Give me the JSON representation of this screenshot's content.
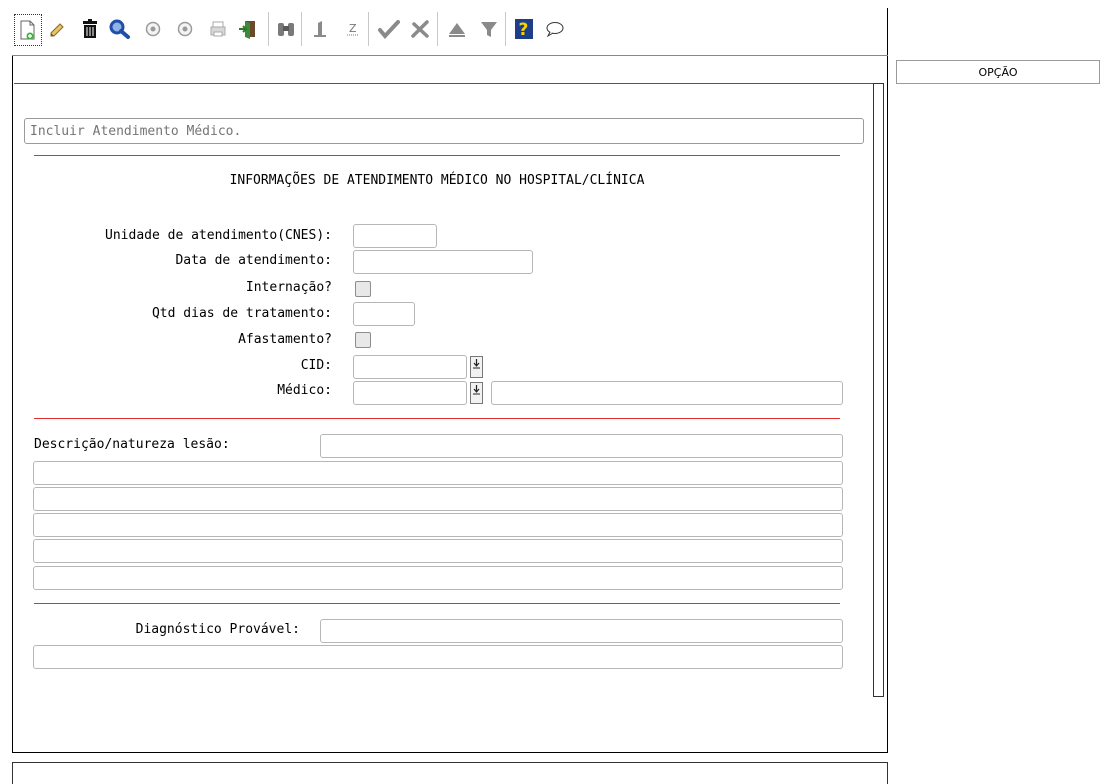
{
  "toolbar": {
    "icons": [
      "new-document-icon",
      "edit-pencil-icon",
      "trash-icon",
      "search-magnifier-icon",
      "previous-circle-icon",
      "next-circle-icon",
      "print-icon",
      "exit-door-icon",
      "binoculars-icon",
      "first-record-icon",
      "last-record-icon",
      "confirm-check-icon",
      "cancel-x-icon",
      "up-arrow-icon",
      "filter-icon",
      "help-question-icon",
      "comment-balloon-icon"
    ]
  },
  "side": {
    "option_label": "OPÇÃO"
  },
  "form": {
    "status_placeholder": "Incluir Atendimento Médico.",
    "section_title": "INFORMAÇÕES DE ATENDIMENTO MÉDICO NO HOSPITAL/CLÍNICA",
    "fields": {
      "cnes_label": "Unidade de atendimento(CNES):",
      "date_label": "Data de atendimento:",
      "internacao_label": "Internação?",
      "qtd_label": "Qtd dias de tratamento:",
      "afastamento_label": "Afastamento?",
      "cid_label": "CID:",
      "medico_label": "Médico:"
    },
    "descricao_label": "Descrição/natureza lesão:",
    "diagnostico_label": "Diagnóstico Provável:"
  },
  "colors": {
    "divider": "#e0302f",
    "input_border": "#b6b6b6"
  }
}
